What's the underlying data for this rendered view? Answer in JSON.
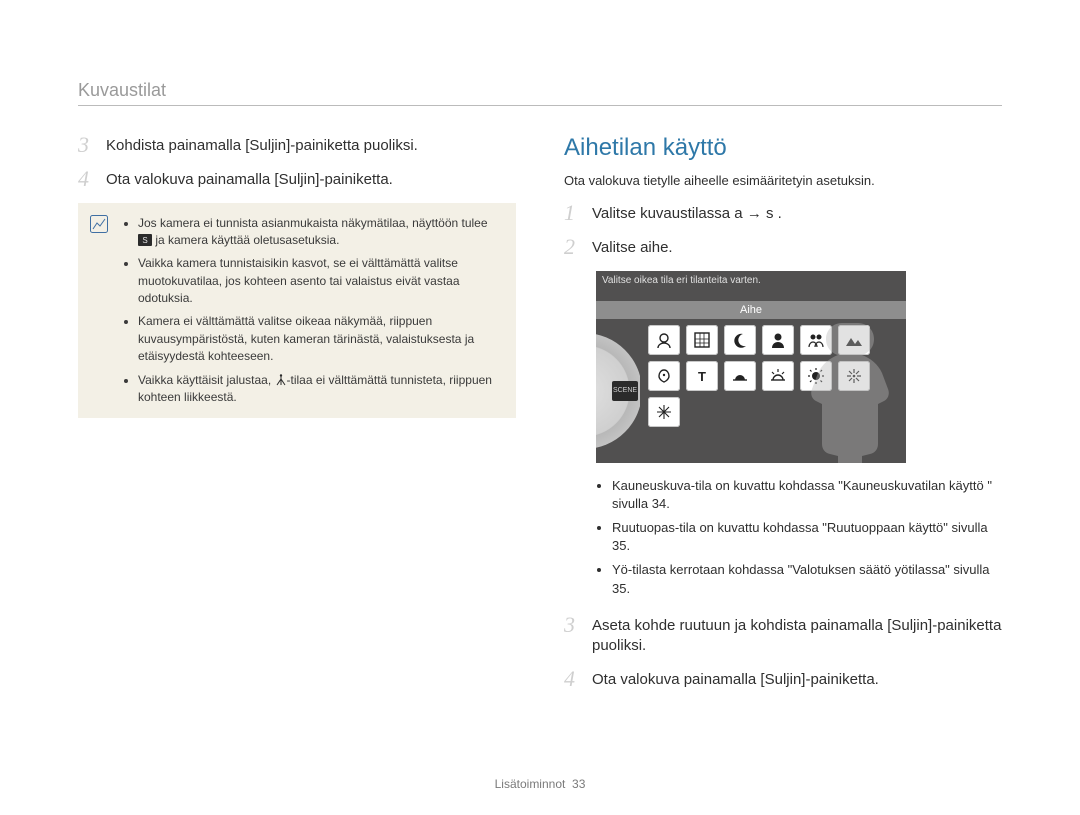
{
  "header": {
    "section": "Kuvaustilat"
  },
  "left": {
    "steps": {
      "3": "Kohdista painamalla [Suljin]-painiketta puoliksi.",
      "4": "Ota valokuva painamalla [Suljin]-painiketta."
    },
    "note_items": {
      "0a": "Jos kamera ei tunnista asianmukaista näkymätilaa, näyttöön tulee ",
      "0b": " ja kamera käyttää oletusasetuksia.",
      "1": "Vaikka kamera tunnistaisikin kasvot, se ei välttämättä valitse muotokuvatilaa, jos kohteen asento tai valaistus eivät vastaa odotuksia.",
      "2": "Kamera ei välttämättä valitse oikeaa näkymää, riippuen kuvausympäristöstä, kuten kameran tärinästä, valaistuksesta ja etäisyydestä kohteeseen.",
      "3a": "Vaikka käyttäisit jalustaa, ",
      "3b": "-tilaa ei välttämättä tunnisteta, riippuen kohteen liikkeestä."
    },
    "note_icons": {
      "0_inline": "S",
      "3_inline": "tripod-icon"
    }
  },
  "right": {
    "title": "Aihetilan käyttö",
    "intro": "Ota valokuva tietylle aiheelle esimääritetyin asetuksin.",
    "steps": {
      "1a": "Valitse kuvaustilassa ",
      "1b": " → ",
      "1c": ".",
      "1_icons": {
        "first": "a",
        "second": "s"
      },
      "2": "Valitse aihe.",
      "3": "Aseta kohde ruutuun ja kohdista painamalla [Suljin]-painiketta puoliksi.",
      "4": "Ota valokuva painamalla [Suljin]-painiketta."
    },
    "preview": {
      "tip": "Valitse oikea tila eri tilanteita varten.",
      "tab_label": "Aihe",
      "mode_wheel_label": "SCENE"
    },
    "subnotes": {
      "0": "Kauneuskuva-tila on kuvattu kohdassa \"Kauneuskuvatilan käyttö \" sivulla 34.",
      "1": "Ruutuopas-tila on kuvattu kohdassa \"Ruutuoppaan käyttö\" sivulla 35.",
      "2": "Yö-tilasta kerrotaan kohdassa \"Valotuksen säätö yötilassa\" sivulla 35."
    }
  },
  "footer": {
    "section": "Lisätoiminnot",
    "page": "33"
  }
}
